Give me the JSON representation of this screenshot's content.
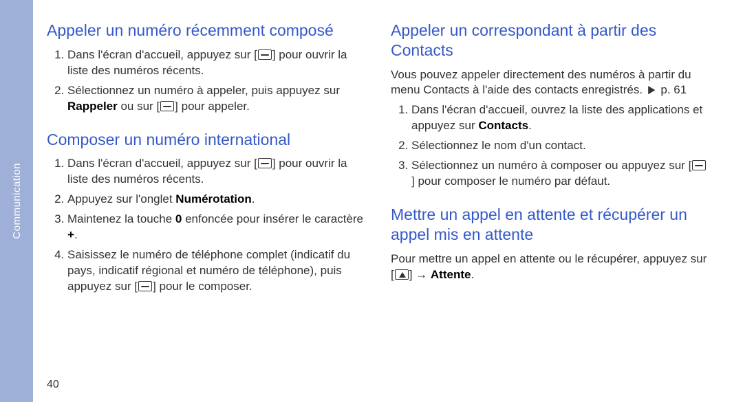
{
  "sidebar": {
    "label": "Communication"
  },
  "page_number": "40",
  "left": {
    "sect1": {
      "title": "Appeler un numéro récemment composé",
      "items": {
        "i1a": "Dans l'écran d'accueil, appuyez sur [",
        "i1b": "] pour ouvrir la liste des numéros récents.",
        "i2a": "Sélectionnez un numéro à appeler, puis appuyez sur ",
        "i2bold": "Rappeler",
        "i2b": " ou sur [",
        "i2c": "] pour appeler."
      }
    },
    "sect2": {
      "title": "Composer un numéro international",
      "items": {
        "i1a": "Dans l'écran d'accueil, appuyez sur [",
        "i1b": "] pour ouvrir la liste des numéros récents.",
        "i2a": "Appuyez sur l'onglet ",
        "i2bold": "Numérotation",
        "i2b": ".",
        "i3a": "Maintenez la touche ",
        "i3bold": "0",
        "i3b": " enfoncée pour insérer le caractère ",
        "i3bold2": "+",
        "i3c": ".",
        "i4a": "Saisissez le numéro de téléphone complet (indicatif du pays, indicatif régional et numéro de téléphone), puis appuyez sur [",
        "i4b": "] pour le composer."
      }
    }
  },
  "right": {
    "sect1": {
      "title": "Appeler un correspondant à partir des Contacts",
      "lead_a": "Vous pouvez appeler directement des numéros à partir du menu Contacts à l'aide des contacts enregistrés. ",
      "lead_chev": "►",
      "lead_b": " p. 61",
      "items": {
        "i1a": "Dans l'écran d'accueil, ouvrez la liste des applications et appuyez sur ",
        "i1bold": "Contacts",
        "i1b": ".",
        "i2": "Sélectionnez le nom d'un contact.",
        "i3a": "Sélectionnez un numéro à composer ou appuyez sur [",
        "i3b": "] pour composer le numéro par défaut."
      }
    },
    "sect2": {
      "title": "Mettre un appel en attente et récupérer un appel mis en attente",
      "lead_a": "Pour mettre un appel en attente ou le récupérer, appuyez sur [",
      "lead_b": "] → ",
      "lead_bold": "Attente",
      "lead_c": "."
    }
  }
}
